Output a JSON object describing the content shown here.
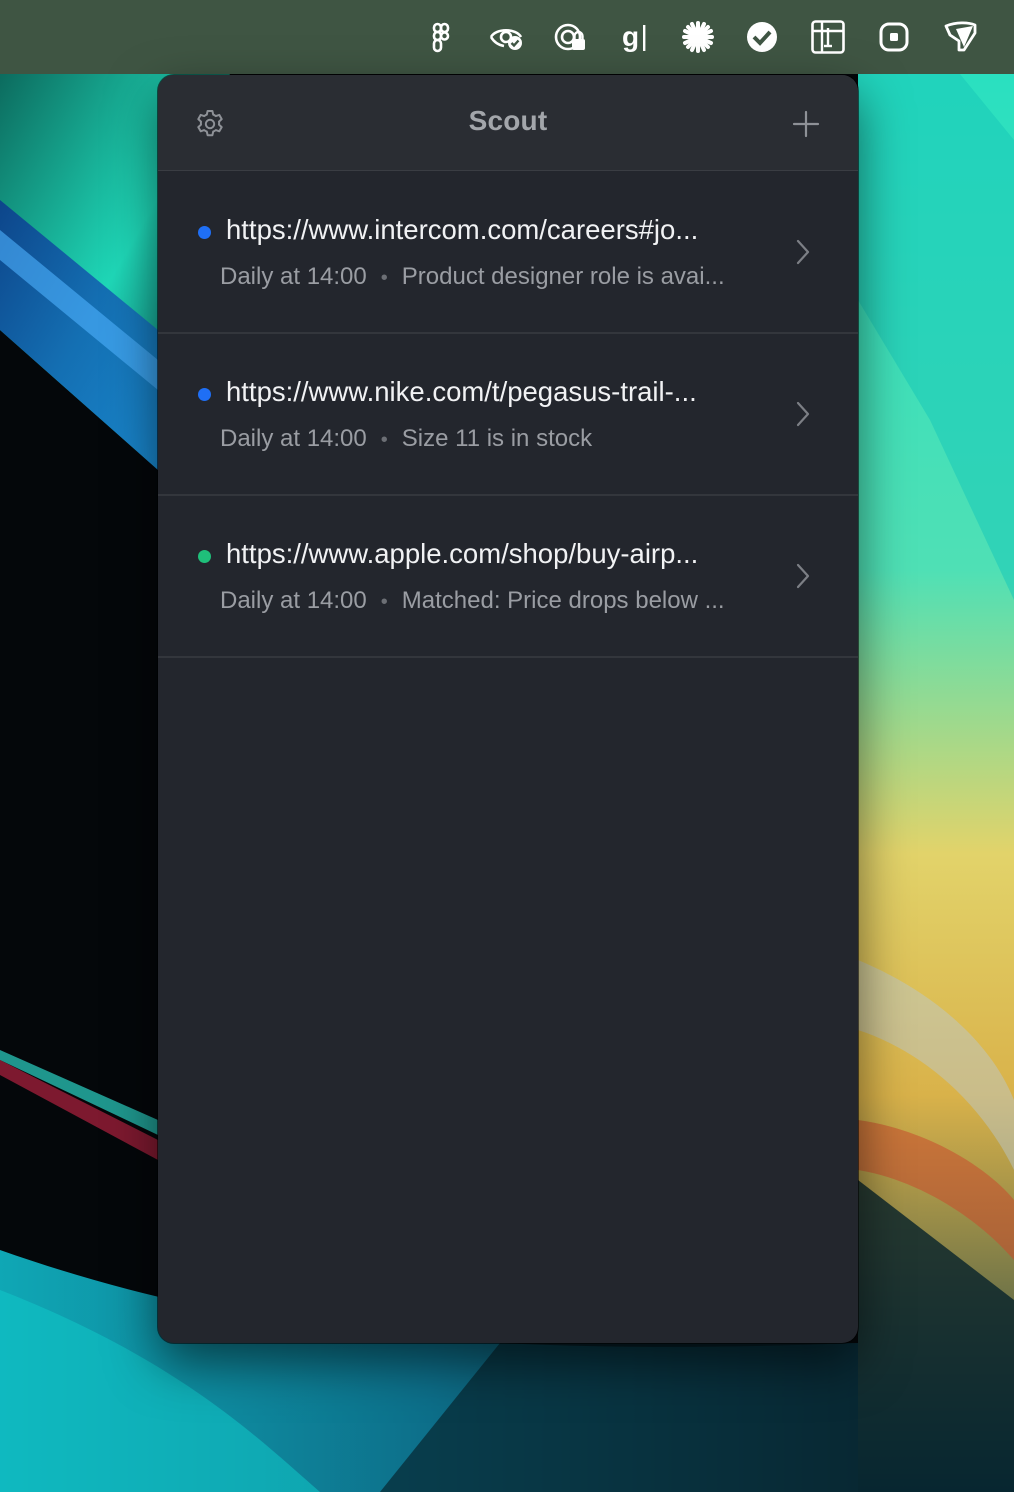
{
  "panel": {
    "title": "Scout"
  },
  "menubar": {
    "icons": [
      "figma-icon",
      "eye-check-icon",
      "password-lock-icon",
      "grammarly-icon",
      "asterisk-icon",
      "check-circle-icon",
      "text-cursor-icon",
      "rounded-square-icon",
      "scout-icon"
    ]
  },
  "watches": [
    {
      "url": "https://www.intercom.com/careers#jo...",
      "schedule": "Daily at 14:00",
      "status": "Product designer role is avai...",
      "dot_color": "#1f6ff5"
    },
    {
      "url": "https://www.nike.com/t/pegasus-trail-...",
      "schedule": "Daily at 14:00",
      "status": "Size 11 is in stock",
      "dot_color": "#1f6ff5"
    },
    {
      "url": "https://www.apple.com/shop/buy-airp...",
      "schedule": "Daily at 14:00",
      "status": "Matched: Price drops below ...",
      "dot_color": "#1fbf7a"
    }
  ]
}
